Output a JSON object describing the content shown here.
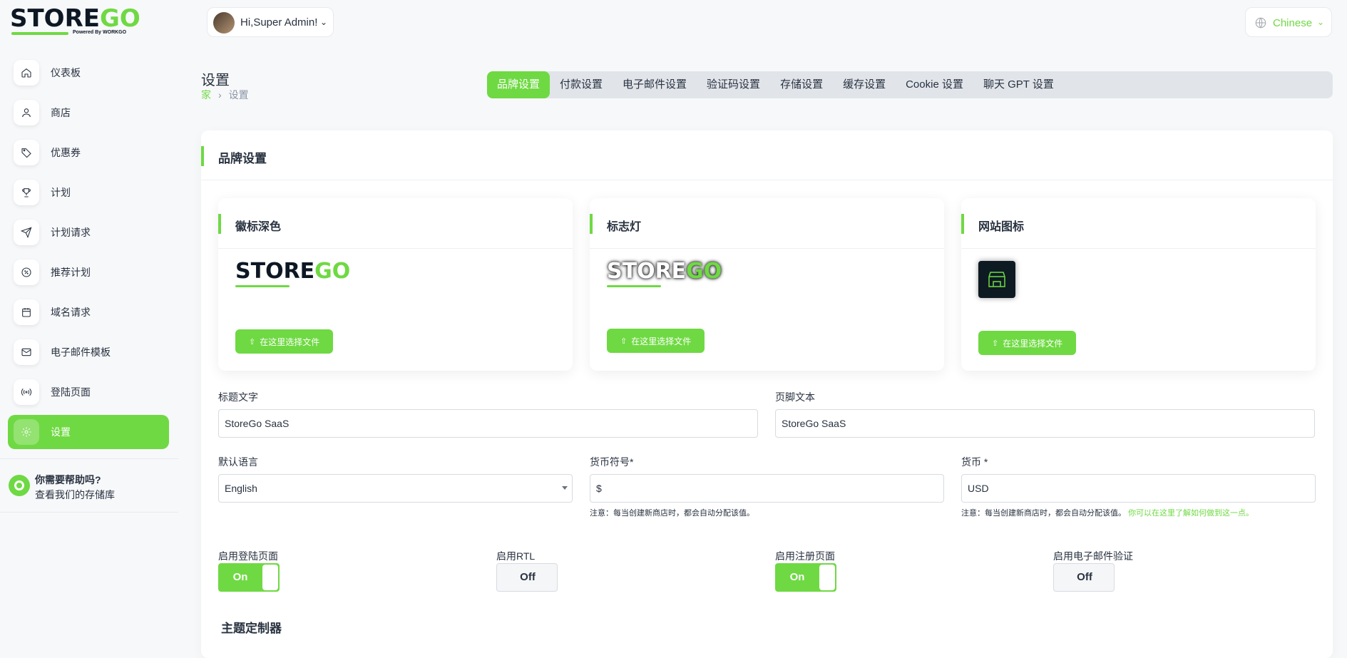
{
  "logo": {
    "main": "STORE",
    "accent": "GO",
    "sub": "Powered By WORKGO"
  },
  "user": {
    "greeting": "Hi,Super Admin!",
    "chevron": "⌄"
  },
  "language": {
    "value": "Chinese",
    "chevron": "⌄"
  },
  "sidebar": {
    "items": [
      {
        "label": "仪表板",
        "icon": "home-icon"
      },
      {
        "label": "商店",
        "icon": "user-icon"
      },
      {
        "label": "优惠券",
        "icon": "tag-icon"
      },
      {
        "label": "计划",
        "icon": "trophy-icon"
      },
      {
        "label": "计划请求",
        "icon": "send-icon"
      },
      {
        "label": "推荐计划",
        "icon": "discount-icon"
      },
      {
        "label": "域名请求",
        "icon": "calendar-icon"
      },
      {
        "label": "电子邮件模板",
        "icon": "mail-icon"
      },
      {
        "label": "登陆页面",
        "icon": "broadcast-icon"
      },
      {
        "label": "设置",
        "icon": "gear-icon",
        "active": true
      }
    ],
    "help": {
      "title": "你需要帮助吗?",
      "subtitle": "查看我们的存储库"
    }
  },
  "page": {
    "title": "设置",
    "breadcrumb": {
      "home": "家",
      "separator": "›",
      "current": "设置"
    }
  },
  "tabs": [
    "品牌设置",
    "付款设置",
    "电子邮件设置",
    "验证码设置",
    "存储设置",
    "缓存设置",
    "Cookie 设置",
    "聊天 GPT 设置"
  ],
  "brand": {
    "title": "品牌设置",
    "cards": [
      {
        "title": "徽标深色",
        "button": "在这里选择文件"
      },
      {
        "title": "标志灯",
        "button": "在这里选择文件"
      },
      {
        "title": "网站图标",
        "button": "在这里选择文件"
      }
    ],
    "upload_icon": "⇧",
    "fields": {
      "title_text": {
        "label": "标题文字",
        "value": "StoreGo SaaS"
      },
      "footer_text": {
        "label": "页脚文本",
        "value": "StoreGo SaaS"
      },
      "default_language": {
        "label": "默认语言",
        "value": "English"
      },
      "currency_symbol": {
        "label": "货币符号*",
        "value": "$",
        "note": "注意：每当创建新商店时，都会自动分配该值。"
      },
      "currency": {
        "label": "货币 *",
        "value": "USD",
        "note": "注意：每当创建新商店时，都会自动分配该值。",
        "link": "你可以在这里了解如何做到这一点。"
      }
    },
    "toggles": [
      {
        "label": "启用登陆页面",
        "state": "On"
      },
      {
        "label": "启用RTL",
        "state": "Off"
      },
      {
        "label": "启用注册页面",
        "state": "On"
      },
      {
        "label": "启用电子邮件验证",
        "state": "Off"
      }
    ],
    "theme_title": "主题定制器"
  },
  "colors": {
    "accent": "#6fd943",
    "text": "#293240",
    "background": "#f7f8fa"
  }
}
